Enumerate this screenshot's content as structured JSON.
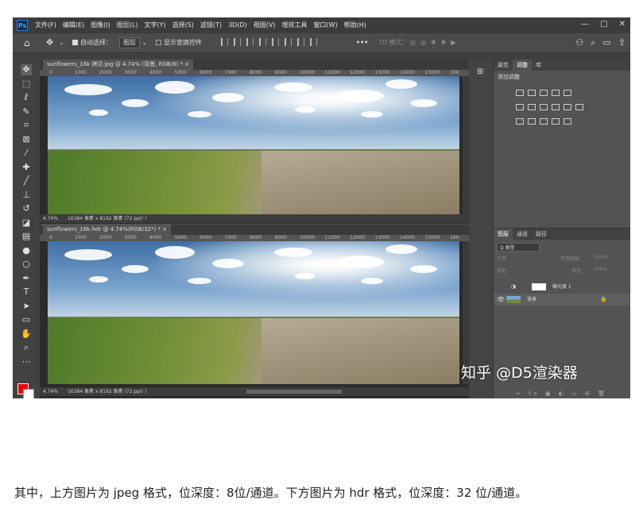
{
  "app": {
    "logo": "Ps"
  },
  "menu": [
    "文件(F)",
    "编辑(E)",
    "图像(I)",
    "图层(L)",
    "文字(Y)",
    "选择(S)",
    "滤镜(T)",
    "3D(D)",
    "视图(V)",
    "增效工具",
    "窗口(W)",
    "帮助(H)"
  ],
  "window_controls": [
    "—",
    "□",
    "✕"
  ],
  "options_bar": {
    "auto_select_label": "自动选择：",
    "auto_select_value": "图层",
    "show_transform_label": "显示变换控件",
    "mode_3d_label": "3D 模式：",
    "more": "•••"
  },
  "tools": [
    "move-icon",
    "marquee-icon",
    "lasso-icon",
    "quick-select-icon",
    "crop-icon",
    "frame-icon",
    "eyedropper-icon",
    "healing-icon",
    "brush-icon",
    "stamp-icon",
    "history-brush-icon",
    "eraser-icon",
    "gradient-icon",
    "blur-icon",
    "dodge-icon",
    "pen-icon",
    "type-icon",
    "path-select-icon",
    "shape-icon",
    "hand-icon",
    "zoom-icon",
    "more-tools-icon"
  ],
  "colors": {
    "foreground": "#e00000",
    "background": "#ffffff"
  },
  "doc1": {
    "tab": "sunflowers_16k 拷贝.jpg @ 4.74% (背景, RGB/8) *  ×",
    "zoom": "4.74%",
    "status": "16384 像素 x 8192 像素 (72 ppi)  〉"
  },
  "doc2": {
    "tab": "sunflowers_16k.hdr @ 4.74%(RGB/32*) *  ×",
    "zoom": "4.74%",
    "status": "16384 像素 x 8192 像素 (72 ppi)  〉"
  },
  "ruler_ticks": [
    "0",
    "1000",
    "2000",
    "3000",
    "4000",
    "5000",
    "6000",
    "7000",
    "8000",
    "9000",
    "10000",
    "11000",
    "12000",
    "13000",
    "14000",
    "15000",
    "160"
  ],
  "adjust_panel": {
    "tabs": [
      "属性",
      "调整",
      "库"
    ],
    "title": "添加调整"
  },
  "layers_panel": {
    "tabs": [
      "图层",
      "通道",
      "路径"
    ],
    "search": "Q 类型",
    "blend_mode": "正常",
    "opacity_label": "不透明度：",
    "opacity_value": "100%",
    "lock_label": "锁定：",
    "fill_label": "填充：",
    "fill_value": "100%",
    "layers": [
      {
        "name": "曝光度 1"
      },
      {
        "name": "背景"
      }
    ]
  },
  "watermark": "知乎 @D5渲染器",
  "caption": "其中，上方图片为 jpeg 格式，位深度：8位/通道。下方图片为 hdr 格式，位深度：32 位/通道。"
}
